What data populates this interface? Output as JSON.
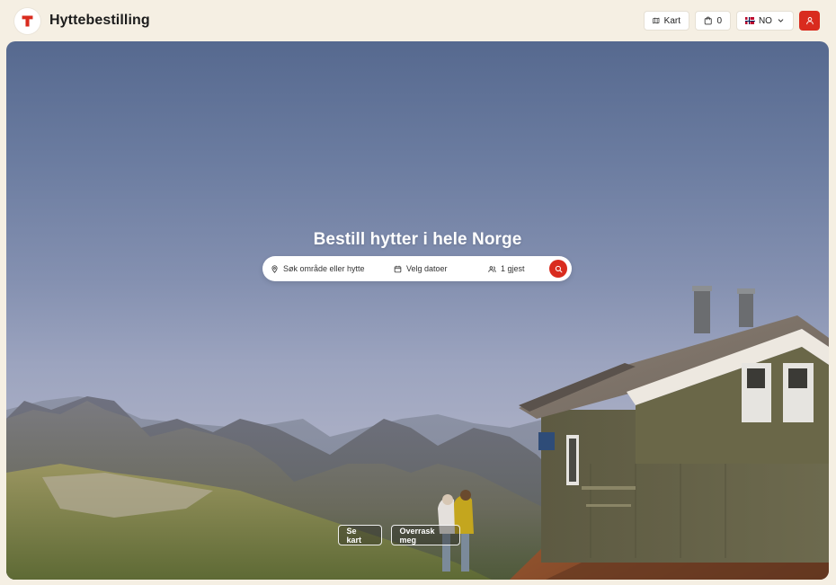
{
  "header": {
    "brand_title": "Hyttebestilling",
    "nav": {
      "map_label": "Kart",
      "cart_count": "0",
      "language_label": "NO"
    }
  },
  "hero": {
    "title": "Bestill hytter i hele Norge",
    "search": {
      "location_label": "Søk område eller hytte",
      "dates_label": "Velg datoer",
      "guests_label": "1 gjest"
    },
    "buttons": {
      "map_label": "Se kart",
      "surprise_label": "Overrask meg"
    }
  },
  "icons": {
    "logo": "dnt-t-logo-icon",
    "map": "map-icon",
    "cart": "shopping-bag-icon",
    "flag": "norway-flag-icon",
    "chevron": "chevron-down-icon",
    "user": "user-icon",
    "location": "location-pin-icon",
    "calendar": "calendar-icon",
    "guests": "users-icon",
    "search": "search-icon"
  },
  "colors": {
    "background": "#f5efe3",
    "accent": "#d92b1e",
    "text": "#1f1f1f"
  }
}
